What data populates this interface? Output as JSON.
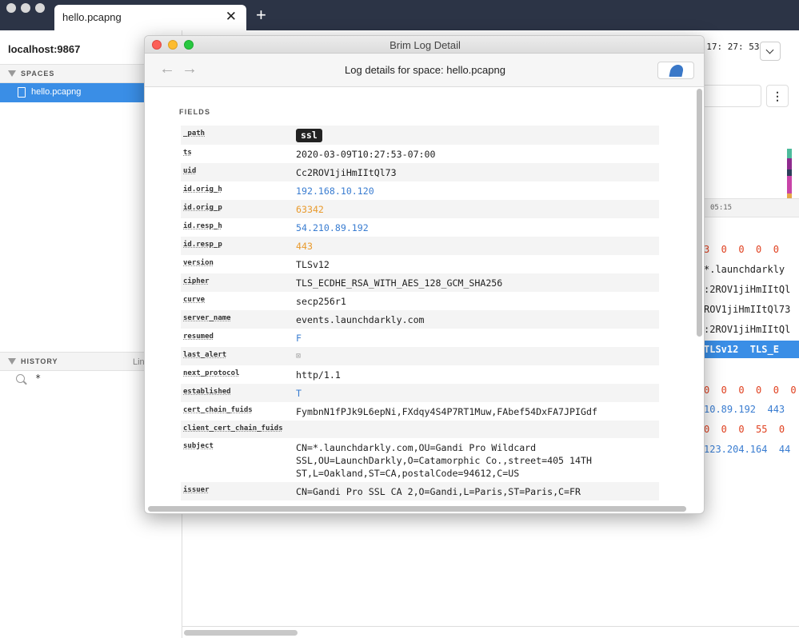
{
  "app": {
    "tab_label": "hello.pcapng",
    "new_tab": "+",
    "close": "✕"
  },
  "sidebar": {
    "host": "localhost:9867",
    "spaces_header": "SPACES",
    "space_item": "hello.pcapng",
    "history_header": "HISTORY",
    "history_extra": "Lin",
    "history_query": "*"
  },
  "main": {
    "time_value": "0  17: 27: 53",
    "axis_tick": "05:15",
    "kebab": "⋮",
    "rows": [
      "3  0  0  0  0",
      "*.launchdarkly",
      ":2ROV1jiHmIItQl",
      "ROV1jiHmIItQl73",
      ":2ROV1jiHmIItQl",
      "TLSv12  TLS_E",
      "0  0  0  0  0  0",
      "10.89.192  443",
      "0  0  0  55  0",
      "123.204.164  44"
    ]
  },
  "modal": {
    "window_title": "Brim Log Detail",
    "subtitle": "Log details for space: hello.pcapng",
    "back": "←",
    "forward": "→",
    "fields_header": "FIELDS",
    "fields": [
      {
        "key": "_path",
        "value": "ssl",
        "kind": "badge"
      },
      {
        "key": "ts",
        "value": "2020-03-09T10:27:53-07:00",
        "kind": "plain"
      },
      {
        "key": "uid",
        "value": "Cc2ROV1jiHmIItQl73",
        "kind": "plain"
      },
      {
        "key": "id.orig_h",
        "value": "192.168.10.120",
        "kind": "blue"
      },
      {
        "key": "id.orig_p",
        "value": "63342",
        "kind": "orange"
      },
      {
        "key": "id.resp_h",
        "value": "54.210.89.192",
        "kind": "blue"
      },
      {
        "key": "id.resp_p",
        "value": "443",
        "kind": "orange"
      },
      {
        "key": "version",
        "value": "TLSv12",
        "kind": "plain"
      },
      {
        "key": "cipher",
        "value": "TLS_ECDHE_RSA_WITH_AES_128_GCM_SHA256",
        "kind": "plain"
      },
      {
        "key": "curve",
        "value": "secp256r1",
        "kind": "plain"
      },
      {
        "key": "server_name",
        "value": "events.launchdarkly.com",
        "kind": "plain"
      },
      {
        "key": "resumed",
        "value": "F",
        "kind": "blue"
      },
      {
        "key": "last_alert",
        "value": "⊠",
        "kind": "unset"
      },
      {
        "key": "next_protocol",
        "value": "http/1.1",
        "kind": "plain"
      },
      {
        "key": "established",
        "value": "T",
        "kind": "blue"
      },
      {
        "key": "cert_chain_fuids",
        "value": "FymbnN1fPJk9L6epNi,FXdqy4S4P7RT1Muw,FAbef54DxFA7JPIGdf",
        "kind": "plain"
      },
      {
        "key": "client_cert_chain_fuids",
        "value": "",
        "kind": "plain"
      },
      {
        "key": "subject",
        "value": "CN=*.launchdarkly.com,OU=Gandi Pro Wildcard SSL,OU=LaunchDarkly,O=Catamorphic Co.,street=405 14TH ST,L=Oakland,ST=CA,postalCode=94612,C=US",
        "kind": "plain"
      },
      {
        "key": "issuer",
        "value": "CN=Gandi Pro SSL CA 2,O=Gandi,L=Paris,ST=Paris,C=FR",
        "kind": "plain"
      },
      {
        "key": "client_subject",
        "value": "⊠",
        "kind": "unset"
      }
    ]
  },
  "colors": {
    "topbar": "#2c3446",
    "accent": "#3a8ee6",
    "addr": "#3a7dd1",
    "port": "#e99a2c",
    "count": "#e0401f",
    "histogram": [
      "#4dbb9c",
      "#8e2b8e",
      "#2c3e5a",
      "#c844a8",
      "#e6a64a"
    ]
  }
}
